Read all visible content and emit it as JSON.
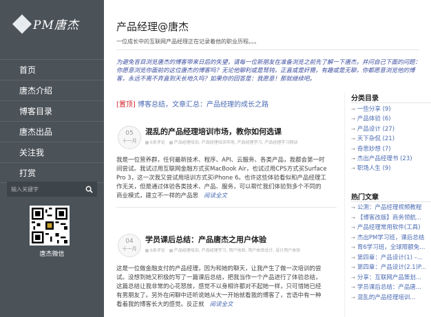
{
  "sidebar": {
    "logo_text": "PM唐杰",
    "nav": [
      "首页",
      "唐杰介绍",
      "博客目录",
      "唐杰出品",
      "关注我",
      "打赏"
    ],
    "search_placeholder": "输入关键字",
    "qr_caption": "唐杰微信"
  },
  "header": {
    "title": "产品经理@唐杰",
    "subtitle": "一位成长中的互联网产品经理正在记录着他的职业历程。。。"
  },
  "intro": [
    "为避免盲目浏览唐杰的博客带来日后的失望，请每一位新朋友在准备浏览之前先了解一下唐杰，并问自己下面的问题：",
    "你愿意浏览你面前的这位唐杰的博客吗？无论他聊利或是驽钝，正直或是奸猾，有趣或是无聊，你都愿意浏览他的博",
    "客，永远不离不弃直到天长地久吗？如果你的回答是：我愿意！那就继续吧。"
  ],
  "pinned": {
    "tag": "[置顶]",
    "text": "博客总结，文章汇总：产品经理的成长之路"
  },
  "posts": [
    {
      "day": "05",
      "month": "十一月",
      "title": "混乱的产品经理培训市场，教你如何选课",
      "meta": [
        "6条评论",
        "产品经理培训",
        "产品经理培训市场",
        "产品经理学习",
        "产品经理学习网站"
      ],
      "body": [
        "我是一位营养群，任何最新技术、程序、API、云服务、各类产品，我都会第一时",
        "间尝试。我试过用互联网金融方式买MacBook Air，也试过用CPS方式买Surface",
        "Pro 3，这一次我又尝试用培训方式买iPhone 6。也许这些体验看似和产品经理工",
        "作无关，但是通过体验各类技术、产品、服务，可以帮忙我们体验到多个不同的",
        "商业模式，建立不一样的产品思"
      ],
      "more": "阅读全文"
    },
    {
      "day": "04",
      "month": "十一月",
      "title": "学员课后总结：产品唐杰之用户体验",
      "meta": [
        "6条评论",
        "产品经理培训",
        "产品经理学习",
        "用户体验",
        "用户体验设计",
        "设计用户体验"
      ],
      "body": [
        "这是一位做金融支付的产品经理，因为和她的聊天，让我产生了做一次培训的尝",
        "试。没想到她又积极的写了一篇课后总结，把我当作一个产品进行了体验总结，",
        "这篇总结让我非常的心花怒放，感觉不以身相许都对不起她一样，只可惜她已经",
        "有男朋友了。另外在闲聊中还听说她从大一开始就看我的博客了，言语中有一种",
        "看着我的博客长大的感觉。反正就"
      ],
      "more": "阅读全文"
    }
  ],
  "categories": {
    "title": "分类目录",
    "items": [
      "一些分享 (9)",
      "产品体验 (6)",
      "产品设计 (27)",
      "天下杂侃 (21)",
      "奇思妙想 (7)",
      "杰出产品经理书 (23)",
      "职场人生 (9)"
    ]
  },
  "hot": {
    "title": "热门文章",
    "items": [
      "公测：产品经理视频教程",
      "【博客改版】商务领航...",
      "产品经理常用软件(工具)",
      "杰出PM学习班，课后总结",
      "育6学习班，全球限额免...",
      "第四章：产品设计(1) –...",
      "第四章：产品设计(2.1)P...",
      "分享：互联网产品策划...",
      "学员课后总结：产品唐...",
      "混乱的产品经理培训..."
    ]
  },
  "colors": {
    "sidebar_bg": "#4b5359",
    "accent_link": "#4a6ab3",
    "pin_tag": "#d3272d",
    "intro_text": "#3a4c9e"
  }
}
